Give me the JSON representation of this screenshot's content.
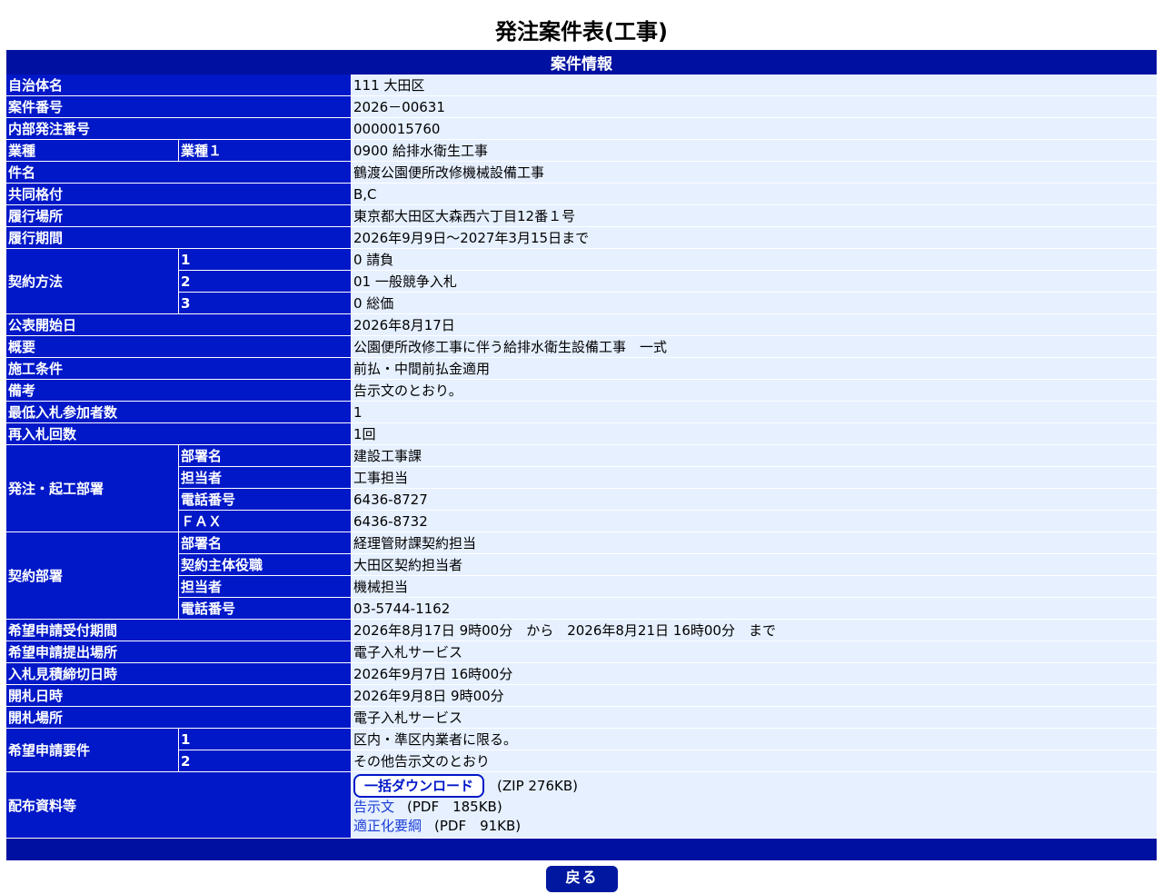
{
  "title": "発注案件表(工事)",
  "section": "案件情報",
  "rows": {
    "jichitai": {
      "label": "自治体名",
      "value": "111 大田区"
    },
    "anken_no": {
      "label": "案件番号",
      "value": "2026－00631"
    },
    "naibu_no": {
      "label": "内部発注番号",
      "value": "0000015760"
    },
    "gyoshu": {
      "label": "業種",
      "sub": "業種１",
      "value": "0900 給排水衛生工事"
    },
    "kenmei": {
      "label": "件名",
      "value": "鶴渡公園便所改修機械設備工事"
    },
    "kyodo": {
      "label": "共同格付",
      "value": "B,C"
    },
    "basho": {
      "label": "履行場所",
      "value": "東京都大田区大森西六丁目12番１号"
    },
    "kikan": {
      "label": "履行期間",
      "value": "2026年9月9日～2027年3月15日まで"
    },
    "keiyaku_houhou": {
      "label": "契約方法",
      "items": [
        {
          "sub": "1",
          "value": "0 請負"
        },
        {
          "sub": "2",
          "value": "01 一般競争入札"
        },
        {
          "sub": "3",
          "value": "0 総価"
        }
      ]
    },
    "kohyo": {
      "label": "公表開始日",
      "value": "2026年8月17日"
    },
    "gaiyo": {
      "label": "概要",
      "value": "公園便所改修工事に伴う給排水衛生設備工事　一式"
    },
    "seko": {
      "label": "施工条件",
      "value": "前払・中間前払金適用"
    },
    "biko": {
      "label": "備考",
      "value": "告示文のとおり。"
    },
    "saitei": {
      "label": "最低入札参加者数",
      "value": "1"
    },
    "sainyu": {
      "label": "再入札回数",
      "value": "1回"
    },
    "hatchu_busho": {
      "label": "発注・起工部署",
      "items": [
        {
          "sub": "部署名",
          "value": "建設工事課"
        },
        {
          "sub": "担当者",
          "value": "工事担当"
        },
        {
          "sub": "電話番号",
          "value": "6436-8727"
        },
        {
          "sub": "ＦＡＸ",
          "value": "6436-8732"
        }
      ]
    },
    "keiyaku_busho": {
      "label": "契約部署",
      "items": [
        {
          "sub": "部署名",
          "value": "経理管財課契約担当"
        },
        {
          "sub": "契約主体役職",
          "value": "大田区契約担当者"
        },
        {
          "sub": "担当者",
          "value": "機械担当"
        },
        {
          "sub": "電話番号",
          "value": "03-5744-1162"
        }
      ]
    },
    "kibo_kikan": {
      "label": "希望申請受付期間",
      "value": "2026年8月17日 9時00分　から　2026年8月21日 16時00分　まで"
    },
    "kibo_basho": {
      "label": "希望申請提出場所",
      "value": "電子入札サービス"
    },
    "shimekiri": {
      "label": "入札見積締切日時",
      "value": "2026年9月7日 16時00分"
    },
    "kaisatsu_nichiji": {
      "label": "開札日時",
      "value": "2026年9月8日 9時00分"
    },
    "kaisatsu_basho": {
      "label": "開札場所",
      "value": "電子入札サービス"
    },
    "kibo_yoken": {
      "label": "希望申請要件",
      "items": [
        {
          "sub": "1",
          "value": "区内・準区内業者に限る。"
        },
        {
          "sub": "2",
          "value": "その他告示文のとおり"
        }
      ]
    },
    "haifu": {
      "label": "配布資料等",
      "download_label": "一括ダウンロード",
      "download_note": "(ZIP 276KB)",
      "files": [
        {
          "name": "告示文",
          "note": "(PDF　185KB)"
        },
        {
          "name": "適正化要綱",
          "note": "(PDF　91KB)"
        }
      ]
    }
  },
  "back_button": "戻る"
}
